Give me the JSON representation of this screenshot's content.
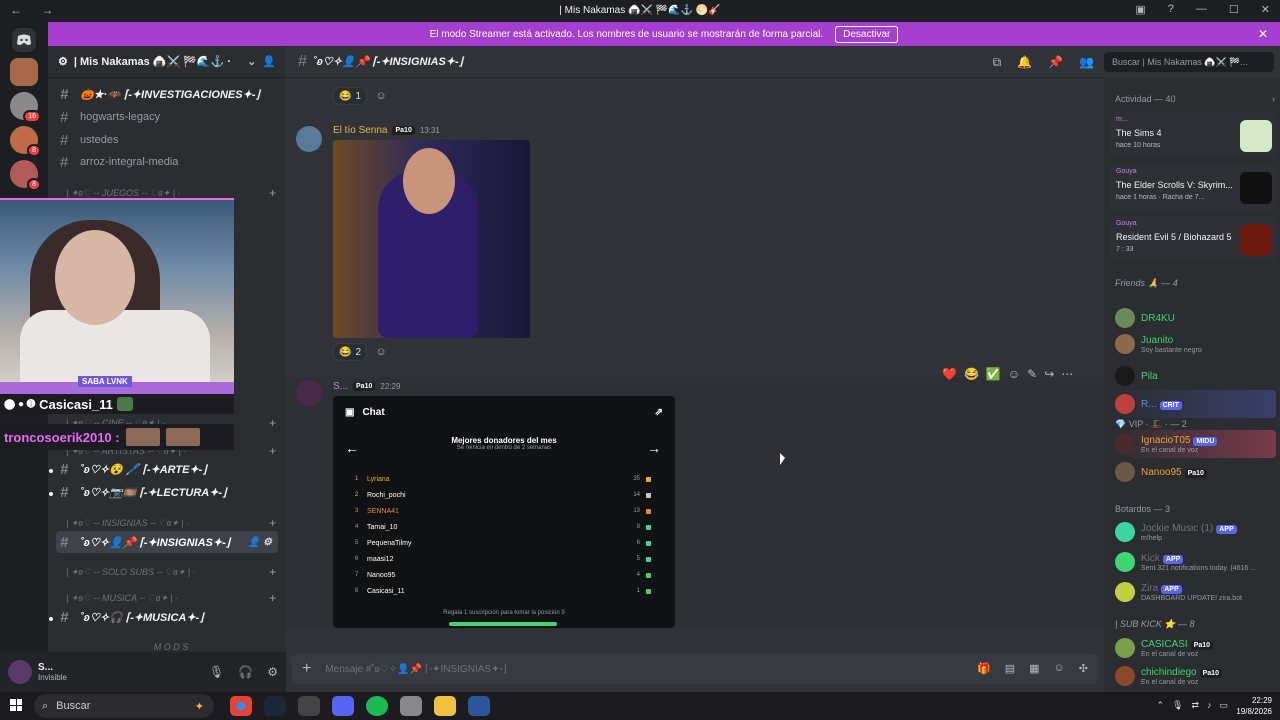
{
  "window": {
    "title": "| Mis Nakamas 🍙⚔️ 🏁🌊⚓ 🌕🎸",
    "nav": "← →",
    "buttons": [
      "▣",
      "?",
      "—",
      "☐",
      "✕"
    ]
  },
  "banner": {
    "text": "El modo Streamer está activado. Los nombres de usuario se mostrarán de forma parcial.",
    "button": "Desactivar",
    "close": "✕"
  },
  "rail": {
    "discord_icon": "discord-logo",
    "badges": [
      "16",
      "8",
      "8"
    ]
  },
  "server": {
    "name": "| Mis Nakamas 🍙⚔️ 🏁🌊⚓ ·",
    "chevron": "⌄"
  },
  "channels": [
    {
      "name": "🎃★·🦇 ⌈-✦INVESTIGACIONES✦-⌋",
      "bold": true
    },
    {
      "name": "hogwarts-legacy"
    },
    {
      "name": "ustedes"
    },
    {
      "name": "arroz-integral-media"
    }
  ],
  "categories": [
    "| ✦ʚ♡ -- JUEGOS -- ♡ɞ✦ | ·",
    "| ✦ʚ♡ -- CINE -- ♡ɞ✦ | ·",
    "| ✦ʚ♡ -- ARTISTAS -- ♡ɞ✦ | ·",
    "| ✦ʚ♡ -- INSIGNIAS -- ♡ɞ✦ | ·",
    "| ✦ʚ♡ -- SOLO SUBS -- ♡ɞ✦ | ·",
    "| ✦ʚ♡ -- MUSICA -- ♡ɞ✦ | ·",
    "M O D S"
  ],
  "channels2": [
    {
      "name": "˚ʚ♡✧😵 🖊️ ⌈-✦ARTE✦-⌋"
    },
    {
      "name": "˚ʚ♡✧📷🎞️ ⌈-✦LECTURA✦-⌋"
    },
    {
      "name": "˚ʚ♡✧👤📌 ⌈-✦INSIGNIAS✦-⌋",
      "active": true
    },
    {
      "name": "˚ʚ♡✧🎧 ⌈-✦MUSICA✦-⌋"
    }
  ],
  "overlay": {
    "tag": "SABA LVNK",
    "alert_name": "Casicasi_11",
    "alert2_name": "troncosoerik2010 :"
  },
  "user": {
    "name": "S...",
    "status": "Invisible"
  },
  "channel_header": {
    "name": "˚ʚ♡✧👤📌 ⌈-✦INSIGNIAS✦-⌋"
  },
  "search": {
    "placeholder": "Buscar | Mis Nakamas 🍙⚔️ 🏁..."
  },
  "messages": [
    {
      "reaction": "😂",
      "count": "1"
    },
    {
      "author": "El tío Senna",
      "badge": "Pa10",
      "time": "13:31",
      "reaction": "😂",
      "count": "2"
    },
    {
      "author": "S...",
      "badge": "Pa10",
      "time": "22:29"
    }
  ],
  "hover_toolbar": [
    "❤️",
    "😂",
    "✅",
    "☺",
    "✎",
    "↪",
    "⋯"
  ],
  "screenshot": {
    "title": "Chat",
    "subtitle": "Mejores donadores del mes",
    "subtitle2": "Se reinicia en dentro de 2 semanas",
    "rows": [
      {
        "rank": "1",
        "name": "Lyriana",
        "value": "35",
        "color": "#e8b21c"
      },
      {
        "rank": "2",
        "name": "Rochi_pochi",
        "value": "14",
        "color": "#c8c8c8"
      },
      {
        "rank": "3",
        "name": "SENNA41",
        "value": "13",
        "color": "#e38a3a"
      },
      {
        "rank": "4",
        "name": "Tamai_10",
        "value": "9",
        "color": "#3ed6a0"
      },
      {
        "rank": "5",
        "name": "PequenaTilmy",
        "value": "6",
        "color": "#3ed6a0"
      },
      {
        "rank": "6",
        "name": "maasi12",
        "value": "5",
        "color": "#3ed6a0"
      },
      {
        "rank": "7",
        "name": "Nanoo95",
        "value": "4",
        "color": "#3ed670"
      },
      {
        "rank": "8",
        "name": "Casicasi_11",
        "value": "1",
        "color": "#3ed670"
      }
    ],
    "footer": "Regala 1 suscripción para tomar la posición 9"
  },
  "composer": {
    "placeholder": "Mensaje #˚ʚ♡✧👤📌 ⌈-✦INSIGNIAS✦-⌋"
  },
  "members": {
    "activity_header": "Actividad — 40",
    "activities": [
      {
        "user": "m...",
        "game": "The Sims 4",
        "time": "hace 10 horas",
        "color": "#d6e8c8"
      },
      {
        "user": "Gouya",
        "game": "The Elder Scrolls V: Skyrim...",
        "time": "hace 1 horas · Racha de 7...",
        "color": "#111111"
      },
      {
        "user": "Gouya",
        "game": "Resident Evil 5 / Biohazard 5",
        "time": "7 : 33",
        "color": "#6b1a10"
      }
    ],
    "friends_header": "Friends 🙏 — 4",
    "friends": [
      {
        "name": "DR4KU",
        "status": "",
        "color": "#3ed670"
      },
      {
        "name": "Juanito",
        "status": "Soy bastante negro",
        "color": "#3ed670"
      },
      {
        "name": "Pila",
        "status": "",
        "color": "#3ed670"
      },
      {
        "name": "R...",
        "status": "",
        "tag": "CRIT",
        "color": "#5a8cf0"
      }
    ],
    "vip_header": "💎 VIP · 🎩 · — 2",
    "vips": [
      {
        "name": "IgnacioT05",
        "status": "En el canal de voz",
        "tag": "MIDU",
        "color": "#e8a338"
      },
      {
        "name": "Nanoo95",
        "status": "",
        "tag": "Pa10",
        "color": "#e8a338"
      }
    ],
    "bots_header": "Botardos — 3",
    "bots": [
      {
        "name": "Jockie Music (1)",
        "status": "m!help",
        "tag": "APP",
        "color": "#6d727a"
      },
      {
        "name": "Kick",
        "status": "Sent 321 notifications today. (4616 ...",
        "tag": "APP",
        "color": "#6d727a"
      },
      {
        "name": "Zira",
        "status": "DASHBOARD UPDATE! zira.bot",
        "tag": "APP",
        "color": "#6d727a"
      }
    ],
    "subkick_header": "| SUB KICK ⭐ — 8",
    "subs": [
      {
        "name": "CASICASI",
        "status": "En el canal de voz",
        "tag": "Pa10",
        "color": "#3ed670"
      },
      {
        "name": "chichindiego",
        "status": "En el canal de voz",
        "tag": "Pa10",
        "color": "#3ed670"
      }
    ]
  },
  "taskbar": {
    "search": "Buscar",
    "time": "22:29",
    "date": "19/8/2026"
  }
}
